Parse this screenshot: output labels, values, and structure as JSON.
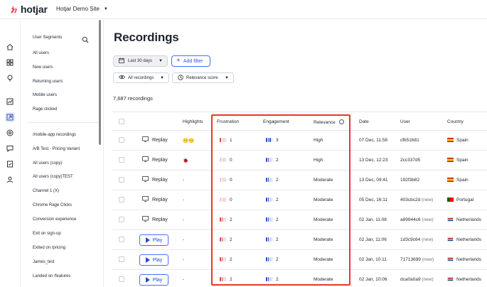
{
  "brand": {
    "name": "hotjar",
    "accent": "#fd3a5c"
  },
  "site_selector": {
    "label": "Hotjar Demo Site"
  },
  "rail": {
    "icons": [
      "home-icon",
      "dashboard-icon",
      "lightbulb-icon",
      "chart-icon",
      "recordings-icon",
      "target-icon",
      "feedback-icon",
      "survey-icon",
      "users-icon"
    ]
  },
  "segments": {
    "title": "User Segments",
    "group1": [
      "All users",
      "New users",
      "Returning users",
      "Mobile users",
      "Rage clicked"
    ],
    "group2": [
      "/mobile-app recordings",
      "A/B Test - Pricing Variant",
      "All users (copy)",
      "All users (copy)TEST",
      "Channel 1 (X)",
      "Chrome Rage Clicks",
      "Conversion experience",
      "Exit on sign-up",
      "Exited on /pricing",
      "James_test",
      "Landed on /features"
    ]
  },
  "main": {
    "title": "Recordings",
    "date_range": "Last 30 days",
    "add_filter": "Add filter",
    "recordings_select": "All recordings",
    "sort_select": "Relevance score",
    "count": "7,687 recordings"
  },
  "table": {
    "headers": {
      "highlights": "Highlights",
      "frustration": "Frustration",
      "engagement": "Engagement",
      "relevance": "Relevance",
      "date": "Date",
      "user": "User",
      "country": "Country"
    },
    "rows": [
      {
        "action": "Replay",
        "highlight": "😶😶",
        "frustration": 1,
        "engagement": 3,
        "relevance": "High",
        "date": "07 Dec, 11:58",
        "user": "cfb51681",
        "new": "",
        "country": "Spain",
        "flag": "es"
      },
      {
        "action": "Replay",
        "highlight": "🐞",
        "frustration": 0,
        "engagement": 2,
        "relevance": "High",
        "date": "13 Dec, 12:23",
        "user": "2cc337d5",
        "new": "",
        "country": "Spain",
        "flag": "es"
      },
      {
        "action": "Replay",
        "highlight": "-",
        "frustration": 0,
        "engagement": 2,
        "relevance": "Moderate",
        "date": "13 Dec, 09:41",
        "user": "192f3b82",
        "new": "",
        "country": "Spain",
        "flag": "es"
      },
      {
        "action": "Replay",
        "highlight": "-",
        "frustration": 0,
        "engagement": 2,
        "relevance": "Moderate",
        "date": "05 Dec, 16:11",
        "user": "403cbc2d",
        "new": "(new)",
        "country": "Portugal",
        "flag": "pt"
      },
      {
        "action": "Replay",
        "highlight": "-",
        "frustration": 2,
        "engagement": 2,
        "relevance": "Moderate",
        "date": "02 Jan, 11:08",
        "user": "a89944c6",
        "new": "(new)",
        "country": "Netherlands",
        "flag": "nl"
      },
      {
        "action": "Play",
        "highlight": "-",
        "frustration": 2,
        "engagement": 2,
        "relevance": "Moderate",
        "date": "02 Jan, 11:06",
        "user": "1d3c9c64",
        "new": "(new)",
        "country": "Netherlands",
        "flag": "nl"
      },
      {
        "action": "Play",
        "highlight": "-",
        "frustration": 2,
        "engagement": 2,
        "relevance": "Moderate",
        "date": "02 Jan, 10:11",
        "user": "71713699",
        "new": "(new)",
        "country": "Netherlands",
        "flag": "nl"
      },
      {
        "action": "Play",
        "highlight": "-",
        "frustration": 2,
        "engagement": 2,
        "relevance": "Moderate",
        "date": "02 Jan, 10:06",
        "user": "dca0a0a9",
        "new": "(new)",
        "country": "Netherlands",
        "flag": "nl"
      }
    ]
  },
  "colors": {
    "frustration_on": "#d64545",
    "frustration_off": "#f2c6c6",
    "engagement_on": "#2c47c9",
    "engagement_off": "#c5cdf0",
    "highlight_box": "#e8372c"
  }
}
